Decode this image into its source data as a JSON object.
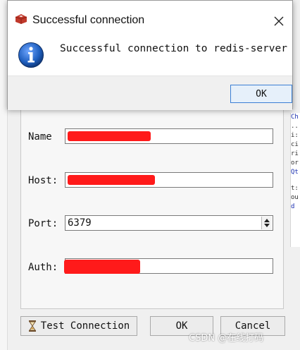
{
  "dialog": {
    "title": "Successful connection",
    "message": "Successful connection to redis-server",
    "ok_label": "OK",
    "close_glyph": "✕"
  },
  "connection_form": {
    "name_label": "Name",
    "host_label": "Host:",
    "port_label": "Port:",
    "port_value": "6379",
    "auth_label": "Auth:"
  },
  "buttons": {
    "test_connection_label": "Test Connection",
    "ok_label": "OK",
    "cancel_label": "Cancel"
  },
  "background_fragments": [
    "Ch",
    "..",
    "i:",
    "ci",
    "ri",
    "or",
    "Qt",
    "t:",
    "ou",
    "d"
  ],
  "watermark": "CSDN @在线打码",
  "icons": {
    "app": "redis-icon",
    "info": "info-icon",
    "close": "close-icon",
    "test": "hourglass-icon"
  },
  "colors": {
    "accent": "#3b7fd4",
    "redaction": "#ff1a1a",
    "info_blue": "#1f5fbf"
  }
}
